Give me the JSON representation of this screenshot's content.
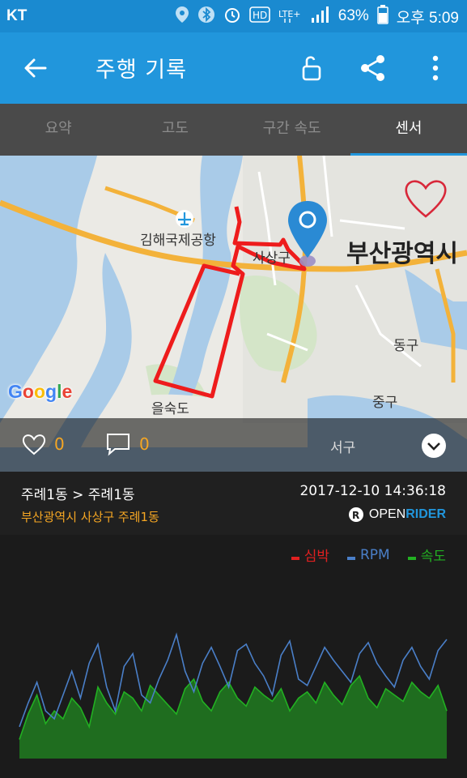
{
  "status_bar": {
    "carrier": "KT",
    "battery": "63%",
    "time": "오후 5:09",
    "icons": [
      "location-icon",
      "bluetooth-icon",
      "alarm-icon",
      "hd-icon",
      "lte-icon",
      "signal-icon",
      "battery-icon"
    ]
  },
  "app_bar": {
    "title": "주행 기록",
    "icons": [
      "back-arrow-icon",
      "unlock-icon",
      "share-icon",
      "more-vert-icon"
    ]
  },
  "tabs": [
    {
      "label": "요약",
      "active": false
    },
    {
      "label": "고도",
      "active": false
    },
    {
      "label": "구간 속도",
      "active": false
    },
    {
      "label": "센서",
      "active": true
    }
  ],
  "map": {
    "labels": {
      "airport": "김해국제공항",
      "city": "부산광역시",
      "sasang": "사상구",
      "dong": "동구",
      "jung": "중구",
      "seo": "서구",
      "eulsukdo": "을숙도"
    },
    "google": "Google"
  },
  "social": {
    "likes": "0",
    "comments": "0"
  },
  "ride": {
    "route": "주례1동 > 주례1동",
    "address": "부산광역시 사상구 주례1동",
    "datetime": "2017-12-10 14:36:18",
    "brand_open": "OPEN",
    "brand_rider": "RIDER",
    "brand_mark": "R"
  },
  "chart_data": {
    "type": "line",
    "series": [
      {
        "name": "심박",
        "color": "#e02020",
        "values": []
      },
      {
        "name": "RPM",
        "color": "#4a7fc8",
        "values": [
          20,
          35,
          48,
          30,
          25,
          40,
          55,
          38,
          60,
          72,
          45,
          30,
          58,
          66,
          40,
          35,
          50,
          62,
          78,
          55,
          42,
          60,
          70,
          58,
          45,
          68,
          72,
          60,
          52,
          40,
          65,
          74,
          50,
          46,
          58,
          70,
          62,
          55,
          48,
          66,
          73,
          60,
          52,
          45,
          62,
          70,
          58,
          50,
          68,
          75
        ]
      },
      {
        "name": "속도",
        "color": "#22b022",
        "values": [
          12,
          28,
          40,
          22,
          30,
          25,
          38,
          32,
          20,
          45,
          35,
          28,
          42,
          38,
          30,
          46,
          40,
          34,
          28,
          44,
          50,
          36,
          30,
          42,
          48,
          38,
          33,
          45,
          40,
          36,
          44,
          30,
          38,
          42,
          35,
          48,
          40,
          34,
          46,
          52,
          38,
          32,
          44,
          40,
          36,
          48,
          42,
          38,
          46,
          30
        ]
      }
    ],
    "legend_position": "top-right"
  },
  "colors": {
    "primary": "#2196dc",
    "accent": "#f5a623",
    "route": "#ee1c1c"
  }
}
